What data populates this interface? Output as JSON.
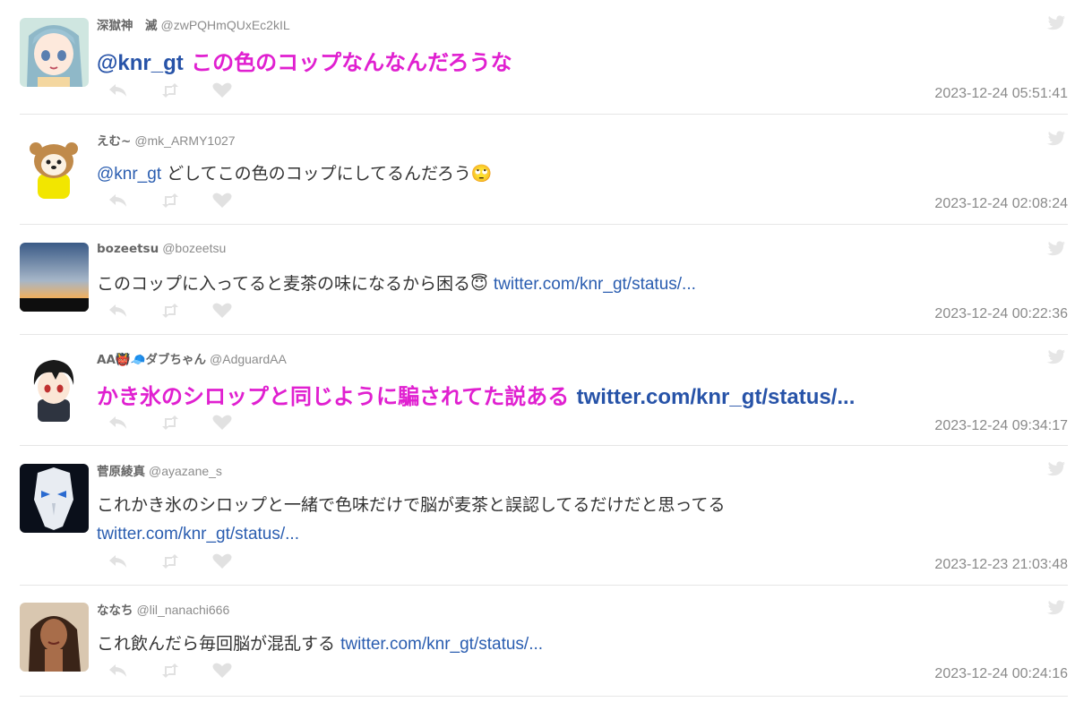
{
  "colors": {
    "link": "#2a5db0",
    "highlight": "#e020d0",
    "icon": "#e1e1e1",
    "date": "#8a8a8a"
  },
  "icons": {
    "reply": "reply-icon",
    "retweet": "retweet-icon",
    "like": "heart-icon",
    "source": "twitter-bird-icon"
  },
  "tweets": [
    {
      "name": "深獄神　滅",
      "handle": "@zwPQHmQUxEc2kIL",
      "mention": "@knr_gt",
      "text": "この色のコップなんなんだろうな",
      "link": "",
      "date": "2023-12-24 05:51:41"
    },
    {
      "name": "えむ~",
      "handle": "@mk_ARMY1027",
      "mention": "@knr_gt",
      "text": "どしてこの色のコップにしてるんだろう🙄",
      "link": "",
      "date": "2023-12-24 02:08:24"
    },
    {
      "name": "bozeetsu",
      "handle": "@bozeetsu",
      "mention": "",
      "text": "このコップに入ってると麦茶の味になるから困る😇",
      "link": "twitter.com/knr_gt/status/...",
      "date": "2023-12-24 00:22:36"
    },
    {
      "name": "AA👹🧢ダブちゃん",
      "handle": "@AdguardAA",
      "mention": "",
      "text": "かき氷のシロップと同じように騙されてた説ある",
      "link": "twitter.com/knr_gt/status/...",
      "date": "2023-12-24 09:34:17"
    },
    {
      "name": "菅原綾真",
      "handle": "@ayazane_s",
      "mention": "",
      "text": "これかき氷のシロップと一緒で色味だけで脳が麦茶と誤認してるだけだと思ってる",
      "link": "twitter.com/knr_gt/status/...",
      "date": "2023-12-23 21:03:48"
    },
    {
      "name": "ななち",
      "handle": "@lil_nanachi666",
      "mention": "",
      "text": "これ飲んだら毎回脳が混乱する",
      "link": "twitter.com/knr_gt/status/...",
      "date": "2023-12-24 00:24:16"
    }
  ]
}
